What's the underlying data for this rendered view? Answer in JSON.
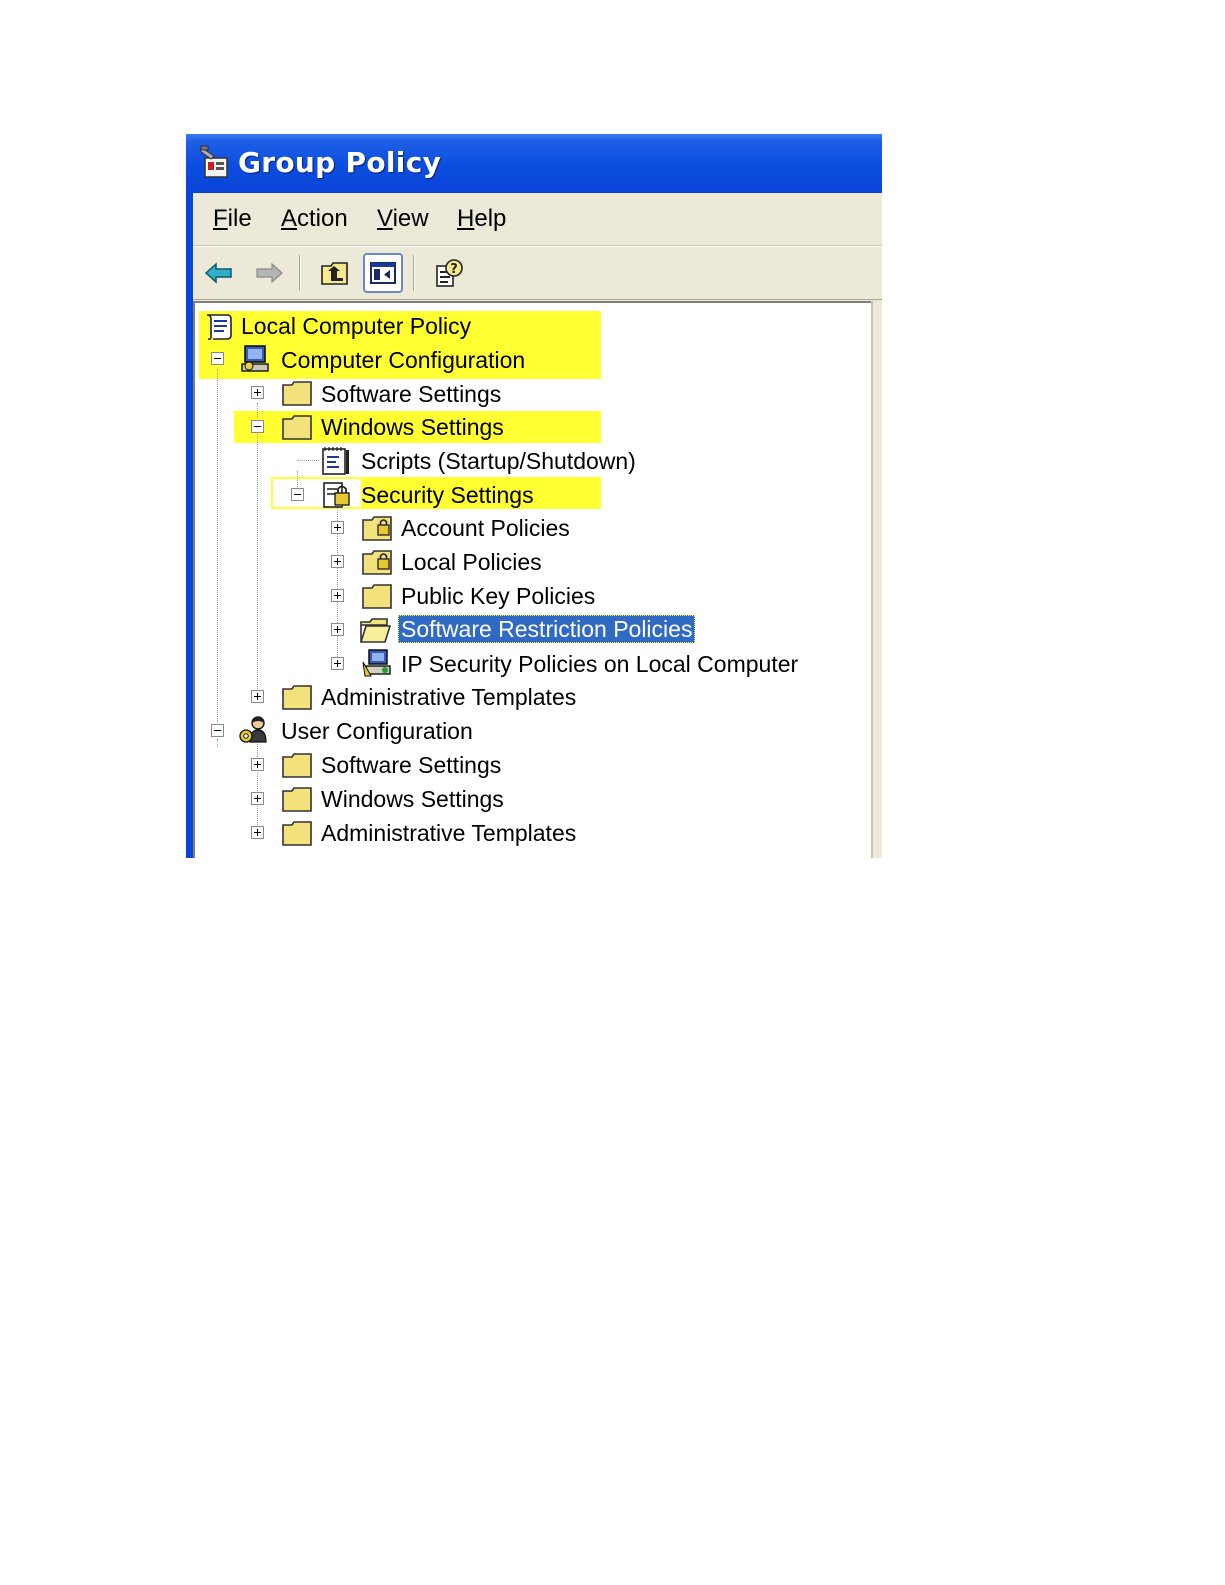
{
  "window": {
    "title": "Group Policy",
    "title_icon": "group-policy-icon",
    "title_bar_color": "#0a44d8"
  },
  "menu": {
    "items": [
      {
        "label_u": "F",
        "label_rest": "ile"
      },
      {
        "label_u": "A",
        "label_rest": "ction"
      },
      {
        "label_u": "V",
        "label_rest": "iew"
      },
      {
        "label_u": "H",
        "label_rest": "elp"
      }
    ]
  },
  "toolbar": {
    "buttons": [
      {
        "icon": "back-arrow-icon"
      },
      {
        "icon": "forward-arrow-icon"
      },
      {
        "icon": "up-one-level-icon"
      },
      {
        "icon": "show-hide-console-tree-icon",
        "pressed": true
      },
      {
        "icon": "help-icon"
      }
    ]
  },
  "highlight_color": "#ffff32",
  "selection_color": "#316ac5",
  "tree": {
    "nodes": [
      {
        "label": "Local Computer Policy",
        "icon": "policy-scroll-icon",
        "expander": "none",
        "highlighted": true
      },
      {
        "label": "Computer Configuration",
        "icon": "computer-config-icon",
        "expander": "minus",
        "highlighted": true
      },
      {
        "label": "Software Settings",
        "icon": "folder-icon",
        "expander": "plus"
      },
      {
        "label": "Windows Settings",
        "icon": "folder-icon",
        "expander": "minus",
        "highlighted": true
      },
      {
        "label": "Scripts (Startup/Shutdown)",
        "icon": "scripts-icon",
        "expander": "none"
      },
      {
        "label": "Security Settings",
        "icon": "security-settings-icon",
        "expander": "minus",
        "highlighted": true
      },
      {
        "label": "Account Policies",
        "icon": "locked-folder-icon",
        "expander": "plus"
      },
      {
        "label": "Local Policies",
        "icon": "locked-folder-icon",
        "expander": "plus"
      },
      {
        "label": "Public Key Policies",
        "icon": "folder-icon",
        "expander": "plus"
      },
      {
        "label": "Software Restriction Policies",
        "icon": "open-folder-icon",
        "expander": "plus",
        "selected": true
      },
      {
        "label": "IP Security Policies on Local Computer",
        "icon": "ip-security-icon",
        "expander": "plus"
      },
      {
        "label": "Administrative Templates",
        "icon": "folder-icon",
        "expander": "plus"
      },
      {
        "label": "User Configuration",
        "icon": "user-config-icon",
        "expander": "minus"
      },
      {
        "label": "Software Settings",
        "icon": "folder-icon",
        "expander": "plus"
      },
      {
        "label": "Windows Settings",
        "icon": "folder-icon",
        "expander": "plus"
      },
      {
        "label": "Administrative Templates",
        "icon": "folder-icon",
        "expander": "plus"
      }
    ]
  }
}
